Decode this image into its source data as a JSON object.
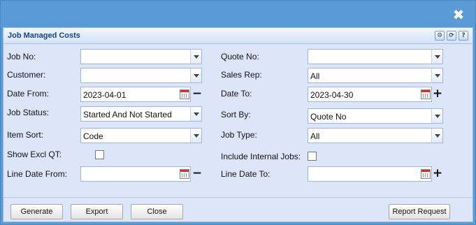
{
  "window": {
    "close_glyph": "✖"
  },
  "panel": {
    "title": "Job Managed Costs",
    "tools": [
      "⚙",
      "⟳",
      "?"
    ]
  },
  "form": {
    "job_no": {
      "label": "Job No:",
      "value": ""
    },
    "quote_no": {
      "label": "Quote No:",
      "value": ""
    },
    "customer": {
      "label": "Customer:",
      "value": ""
    },
    "sales_rep": {
      "label": "Sales Rep:",
      "value": "All"
    },
    "date_from": {
      "label": "Date From:",
      "value": "2023-04-01",
      "action": "−"
    },
    "date_to": {
      "label": "Date To:",
      "value": "2023-04-30",
      "action": "+"
    },
    "job_status": {
      "label": "Job Status:",
      "value": "Started And Not Started"
    },
    "sort_by": {
      "label": "Sort By:",
      "value": "Quote No"
    },
    "item_sort": {
      "label": "Item Sort:",
      "value": "Code"
    },
    "job_type": {
      "label": "Job Type:",
      "value": "All"
    },
    "show_excl_qt": {
      "label": "Show Excl QT:",
      "checked": false
    },
    "include_internal": {
      "label": "Include Internal Jobs:",
      "checked": false
    },
    "line_date_from": {
      "label": "Line Date From:",
      "value": "",
      "action": "−"
    },
    "line_date_to": {
      "label": "Line Date To:",
      "value": "",
      "action": "+"
    }
  },
  "buttons": {
    "generate": "Generate",
    "export": "Export",
    "close": "Close",
    "report_request": "Report Request"
  },
  "icons": {
    "close": "close-icon",
    "settings": "gear-icon",
    "refresh": "refresh-icon",
    "help": "help-icon",
    "calendar": "calendar-icon",
    "dropdown": "chevron-down-icon"
  }
}
